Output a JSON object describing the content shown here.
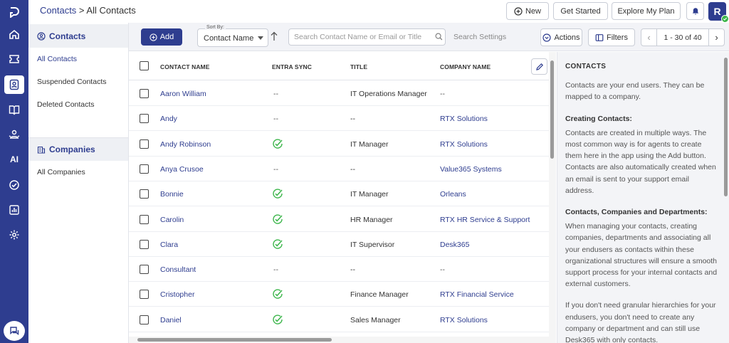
{
  "header": {
    "breadcrumb_link": "Contacts",
    "breadcrumb_sep": " > ",
    "breadcrumb_current": "All Contacts",
    "new_label": "New",
    "get_started_label": "Get Started",
    "explore_plan_label": "Explore My Plan",
    "avatar_letter": "R"
  },
  "rail": {
    "ai_label": "AI",
    "icons": [
      "logo-icon",
      "home-icon",
      "tickets-icon",
      "contacts-icon",
      "knowledge-base-icon",
      "service-desk-icon",
      "ai-icon",
      "tasks-icon",
      "reports-icon",
      "settings-icon",
      "chat-icon"
    ]
  },
  "leftnav": {
    "contacts_section": "Contacts",
    "contacts_items": [
      "All Contacts",
      "Suspended Contacts",
      "Deleted Contacts"
    ],
    "companies_section": "Companies",
    "companies_items": [
      "All Companies"
    ]
  },
  "toolbar": {
    "add_label": "Add",
    "sort_by_label": "Sort By:",
    "sort_value": "Contact Name",
    "search_placeholder": "Search Contact Name or Email or Title",
    "search_settings": "Search Settings",
    "actions_label": "Actions",
    "filters_label": "Filters",
    "pagination": "1 - 30 of 40"
  },
  "table": {
    "headers": [
      "CONTACT NAME",
      "ENTRA SYNC",
      "TITLE",
      "COMPANY NAME"
    ],
    "rows": [
      {
        "name": "Aaron William",
        "sync": false,
        "title": "IT Operations Manager",
        "company": "--"
      },
      {
        "name": "Andy",
        "sync": false,
        "title": "--",
        "company": "RTX Solutions"
      },
      {
        "name": "Andy Robinson",
        "sync": true,
        "title": "IT Manager",
        "company": "RTX Solutions"
      },
      {
        "name": "Anya Crusoe",
        "sync": false,
        "title": "--",
        "company": "Value365 Systems"
      },
      {
        "name": "Bonnie",
        "sync": true,
        "title": "IT Manager",
        "company": "Orleans"
      },
      {
        "name": "Carolin",
        "sync": true,
        "title": "HR Manager",
        "company": "RTX HR Service & Support"
      },
      {
        "name": "Clara",
        "sync": true,
        "title": "IT Supervisor",
        "company": "Desk365"
      },
      {
        "name": "Consultant",
        "sync": false,
        "title": "--",
        "company": "--"
      },
      {
        "name": "Cristopher",
        "sync": true,
        "title": "Finance Manager",
        "company": "RTX Financial Service"
      },
      {
        "name": "Daniel",
        "sync": true,
        "title": "Sales Manager",
        "company": "RTX Solutions"
      }
    ],
    "empty_sync": "--"
  },
  "help": {
    "heading": "CONTACTS",
    "intro": "Contacts are your end users. They can be mapped to a company.",
    "creating_title": "Creating Contacts:",
    "creating_body": "Contacts are created in multiple ways. The most common way is for agents to create them here in the app using the Add button. Contacts are also automatically created when an email is sent to your support email address.",
    "ccd_title": "Contacts, Companies and Departments:",
    "ccd_body": "When managing your contacts, creating companies, departments and associating all your endusers as contacts within these organizational structures will ensure a smooth support process for your internal contacts and external customers.",
    "granular_body": "If you don't need granular hierarchies for your endusers, you don't need to create any company or department and can still use Desk365 with only contacts."
  },
  "colors": {
    "primary": "#2e3d8f",
    "success": "#3bb54a",
    "rail_bg": "#2e3d8f"
  }
}
